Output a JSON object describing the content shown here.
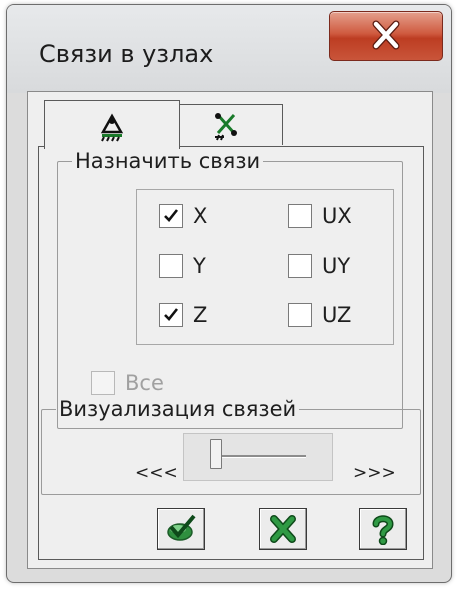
{
  "window": {
    "title": "Связи в узлах",
    "close_icon": "close-x-icon"
  },
  "tabs": [
    {
      "icon": "node-support-icon",
      "active": true
    },
    {
      "icon": "support-release-icon",
      "active": false
    }
  ],
  "assign_group": {
    "legend": "Назначить связи",
    "checkboxes": [
      {
        "label": "X",
        "checked": true
      },
      {
        "label": "UX",
        "checked": false
      },
      {
        "label": "Y",
        "checked": false
      },
      {
        "label": "UY",
        "checked": false
      },
      {
        "label": "Z",
        "checked": true
      },
      {
        "label": "UZ",
        "checked": false
      }
    ],
    "all": {
      "label": "Все",
      "checked": false,
      "enabled": false
    }
  },
  "visual_group": {
    "legend": "Визуализация связей",
    "decrease_label": "<<<",
    "increase_label": ">>>",
    "slider_level": 0
  },
  "buttons": [
    {
      "icon": "apply-check-icon",
      "color": "#1c8a3a"
    },
    {
      "icon": "cancel-x-icon",
      "color": "#1c8a3a"
    },
    {
      "icon": "help-question-icon",
      "color": "#1c8a3a"
    }
  ]
}
